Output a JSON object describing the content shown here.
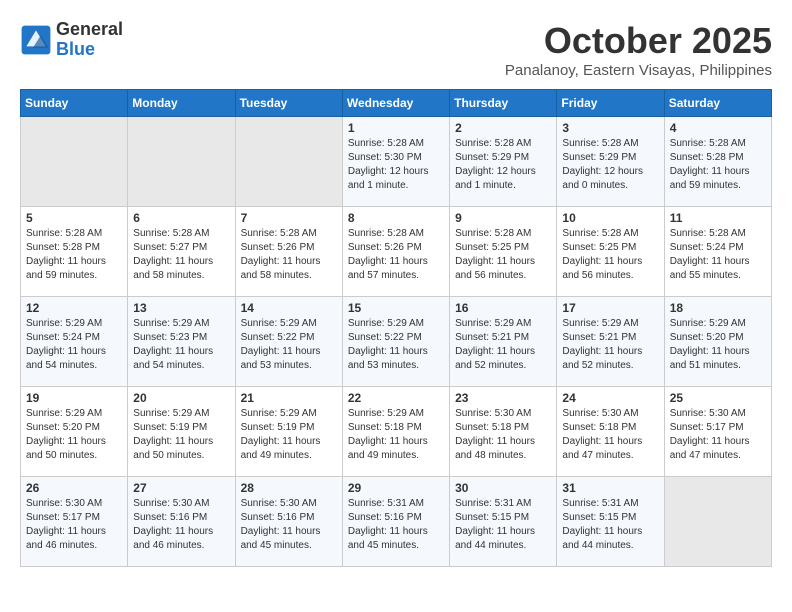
{
  "logo": {
    "general": "General",
    "blue": "Blue"
  },
  "title": "October 2025",
  "location": "Panalanoy, Eastern Visayas, Philippines",
  "weekdays": [
    "Sunday",
    "Monday",
    "Tuesday",
    "Wednesday",
    "Thursday",
    "Friday",
    "Saturday"
  ],
  "weeks": [
    [
      {
        "day": "",
        "empty": true
      },
      {
        "day": "",
        "empty": true
      },
      {
        "day": "",
        "empty": true
      },
      {
        "day": "1",
        "sunrise": "Sunrise: 5:28 AM",
        "sunset": "Sunset: 5:30 PM",
        "daylight": "Daylight: 12 hours and 1 minute."
      },
      {
        "day": "2",
        "sunrise": "Sunrise: 5:28 AM",
        "sunset": "Sunset: 5:29 PM",
        "daylight": "Daylight: 12 hours and 1 minute."
      },
      {
        "day": "3",
        "sunrise": "Sunrise: 5:28 AM",
        "sunset": "Sunset: 5:29 PM",
        "daylight": "Daylight: 12 hours and 0 minutes."
      },
      {
        "day": "4",
        "sunrise": "Sunrise: 5:28 AM",
        "sunset": "Sunset: 5:28 PM",
        "daylight": "Daylight: 11 hours and 59 minutes."
      }
    ],
    [
      {
        "day": "5",
        "sunrise": "Sunrise: 5:28 AM",
        "sunset": "Sunset: 5:28 PM",
        "daylight": "Daylight: 11 hours and 59 minutes."
      },
      {
        "day": "6",
        "sunrise": "Sunrise: 5:28 AM",
        "sunset": "Sunset: 5:27 PM",
        "daylight": "Daylight: 11 hours and 58 minutes."
      },
      {
        "day": "7",
        "sunrise": "Sunrise: 5:28 AM",
        "sunset": "Sunset: 5:26 PM",
        "daylight": "Daylight: 11 hours and 58 minutes."
      },
      {
        "day": "8",
        "sunrise": "Sunrise: 5:28 AM",
        "sunset": "Sunset: 5:26 PM",
        "daylight": "Daylight: 11 hours and 57 minutes."
      },
      {
        "day": "9",
        "sunrise": "Sunrise: 5:28 AM",
        "sunset": "Sunset: 5:25 PM",
        "daylight": "Daylight: 11 hours and 56 minutes."
      },
      {
        "day": "10",
        "sunrise": "Sunrise: 5:28 AM",
        "sunset": "Sunset: 5:25 PM",
        "daylight": "Daylight: 11 hours and 56 minutes."
      },
      {
        "day": "11",
        "sunrise": "Sunrise: 5:28 AM",
        "sunset": "Sunset: 5:24 PM",
        "daylight": "Daylight: 11 hours and 55 minutes."
      }
    ],
    [
      {
        "day": "12",
        "sunrise": "Sunrise: 5:29 AM",
        "sunset": "Sunset: 5:24 PM",
        "daylight": "Daylight: 11 hours and 54 minutes."
      },
      {
        "day": "13",
        "sunrise": "Sunrise: 5:29 AM",
        "sunset": "Sunset: 5:23 PM",
        "daylight": "Daylight: 11 hours and 54 minutes."
      },
      {
        "day": "14",
        "sunrise": "Sunrise: 5:29 AM",
        "sunset": "Sunset: 5:22 PM",
        "daylight": "Daylight: 11 hours and 53 minutes."
      },
      {
        "day": "15",
        "sunrise": "Sunrise: 5:29 AM",
        "sunset": "Sunset: 5:22 PM",
        "daylight": "Daylight: 11 hours and 53 minutes."
      },
      {
        "day": "16",
        "sunrise": "Sunrise: 5:29 AM",
        "sunset": "Sunset: 5:21 PM",
        "daylight": "Daylight: 11 hours and 52 minutes."
      },
      {
        "day": "17",
        "sunrise": "Sunrise: 5:29 AM",
        "sunset": "Sunset: 5:21 PM",
        "daylight": "Daylight: 11 hours and 52 minutes."
      },
      {
        "day": "18",
        "sunrise": "Sunrise: 5:29 AM",
        "sunset": "Sunset: 5:20 PM",
        "daylight": "Daylight: 11 hours and 51 minutes."
      }
    ],
    [
      {
        "day": "19",
        "sunrise": "Sunrise: 5:29 AM",
        "sunset": "Sunset: 5:20 PM",
        "daylight": "Daylight: 11 hours and 50 minutes."
      },
      {
        "day": "20",
        "sunrise": "Sunrise: 5:29 AM",
        "sunset": "Sunset: 5:19 PM",
        "daylight": "Daylight: 11 hours and 50 minutes."
      },
      {
        "day": "21",
        "sunrise": "Sunrise: 5:29 AM",
        "sunset": "Sunset: 5:19 PM",
        "daylight": "Daylight: 11 hours and 49 minutes."
      },
      {
        "day": "22",
        "sunrise": "Sunrise: 5:29 AM",
        "sunset": "Sunset: 5:18 PM",
        "daylight": "Daylight: 11 hours and 49 minutes."
      },
      {
        "day": "23",
        "sunrise": "Sunrise: 5:30 AM",
        "sunset": "Sunset: 5:18 PM",
        "daylight": "Daylight: 11 hours and 48 minutes."
      },
      {
        "day": "24",
        "sunrise": "Sunrise: 5:30 AM",
        "sunset": "Sunset: 5:18 PM",
        "daylight": "Daylight: 11 hours and 47 minutes."
      },
      {
        "day": "25",
        "sunrise": "Sunrise: 5:30 AM",
        "sunset": "Sunset: 5:17 PM",
        "daylight": "Daylight: 11 hours and 47 minutes."
      }
    ],
    [
      {
        "day": "26",
        "sunrise": "Sunrise: 5:30 AM",
        "sunset": "Sunset: 5:17 PM",
        "daylight": "Daylight: 11 hours and 46 minutes."
      },
      {
        "day": "27",
        "sunrise": "Sunrise: 5:30 AM",
        "sunset": "Sunset: 5:16 PM",
        "daylight": "Daylight: 11 hours and 46 minutes."
      },
      {
        "day": "28",
        "sunrise": "Sunrise: 5:30 AM",
        "sunset": "Sunset: 5:16 PM",
        "daylight": "Daylight: 11 hours and 45 minutes."
      },
      {
        "day": "29",
        "sunrise": "Sunrise: 5:31 AM",
        "sunset": "Sunset: 5:16 PM",
        "daylight": "Daylight: 11 hours and 45 minutes."
      },
      {
        "day": "30",
        "sunrise": "Sunrise: 5:31 AM",
        "sunset": "Sunset: 5:15 PM",
        "daylight": "Daylight: 11 hours and 44 minutes."
      },
      {
        "day": "31",
        "sunrise": "Sunrise: 5:31 AM",
        "sunset": "Sunset: 5:15 PM",
        "daylight": "Daylight: 11 hours and 44 minutes."
      },
      {
        "day": "",
        "empty": true
      }
    ]
  ]
}
